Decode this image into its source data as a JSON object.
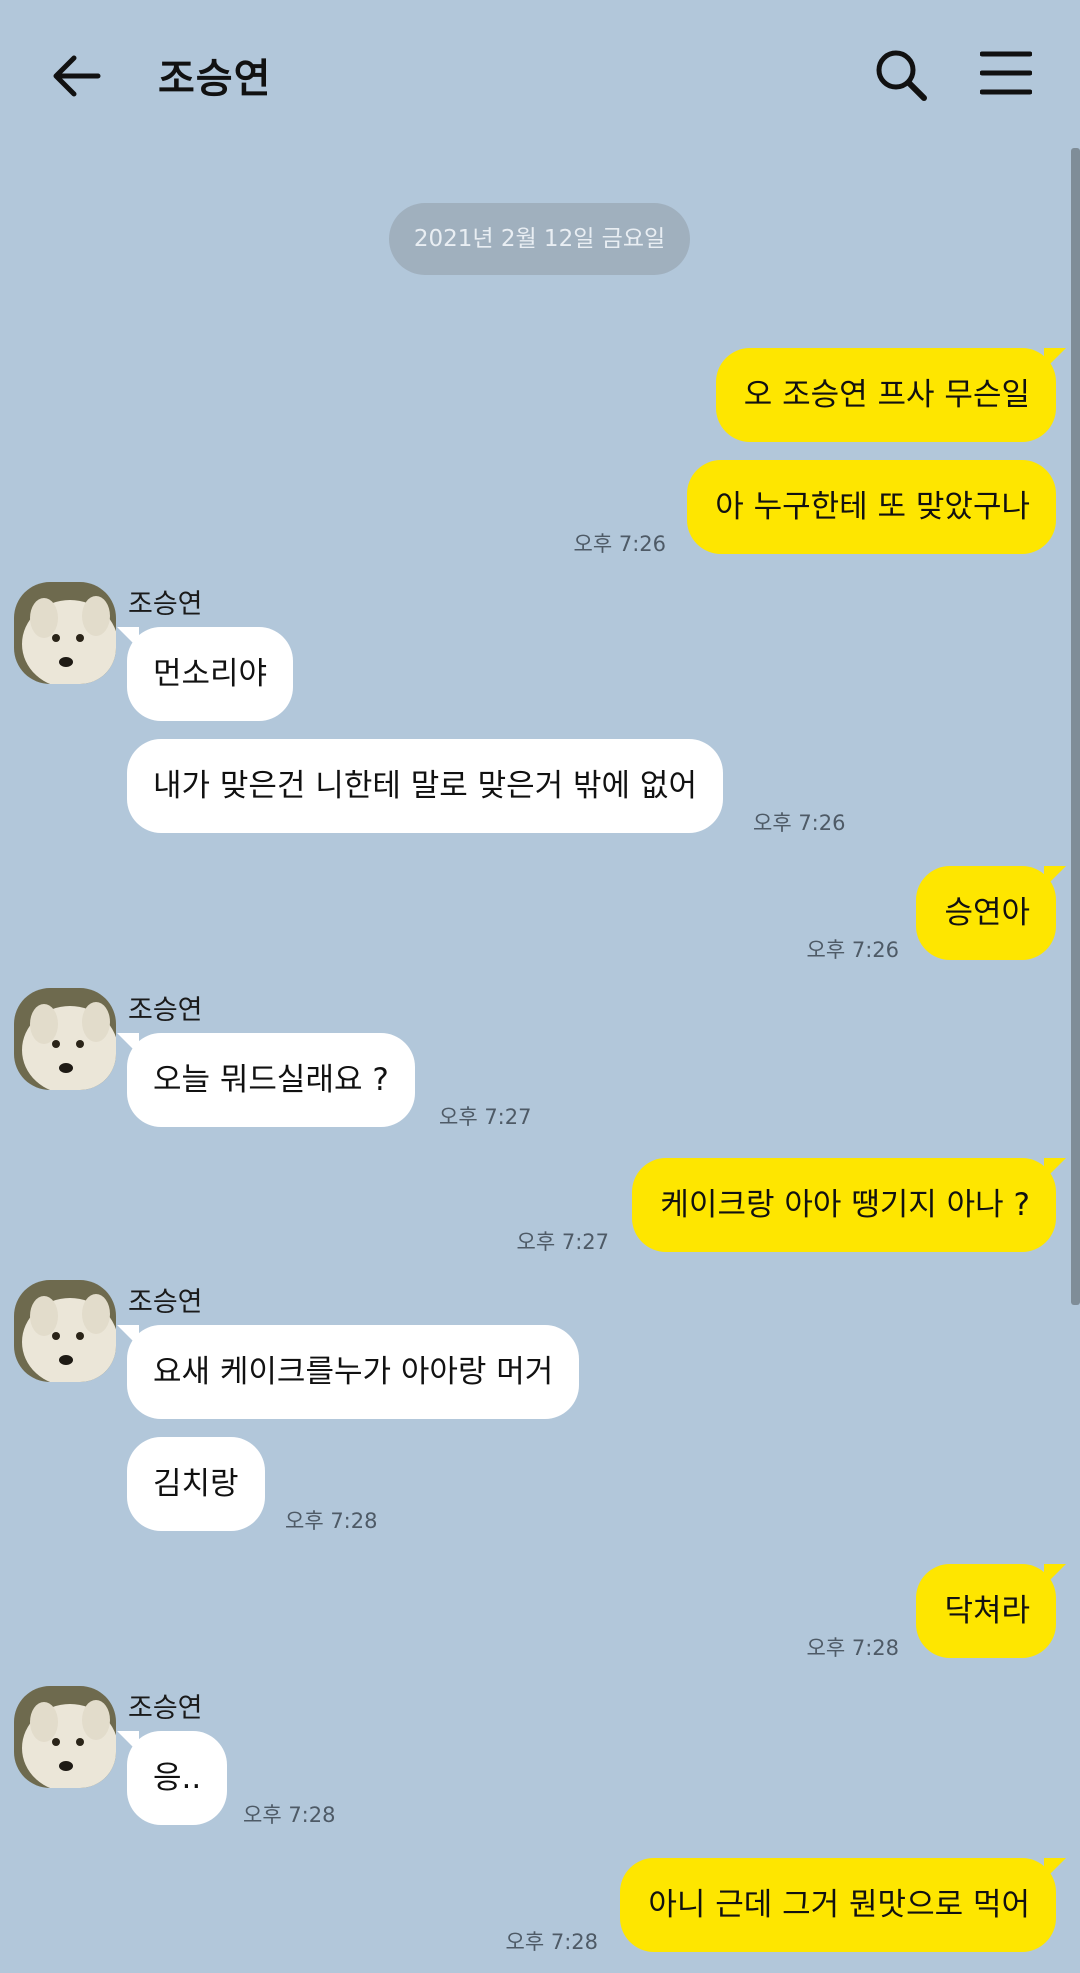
{
  "header": {
    "title": "조승연"
  },
  "date_divider": "2021년 2월 12일 금요일",
  "contact": {
    "name": "조승연"
  },
  "messages": [
    {
      "text": "오 조승연 프사 무슨일",
      "time": ""
    },
    {
      "text": "아 누구한테 또 맞았구나",
      "time": "오후 7:26"
    },
    {
      "text": "먼소리야",
      "time": ""
    },
    {
      "text": "내가 맞은건 니한테 말로 맞은거 밖에 없어",
      "time": "오후 7:26"
    },
    {
      "text": "승연아",
      "time": "오후 7:26"
    },
    {
      "text": "오늘 뭐드실래요 ?",
      "time": "오후 7:27"
    },
    {
      "text": "케이크랑 아아 땡기지 아나 ?",
      "time": "오후 7:27"
    },
    {
      "text": "요새 케이크를누가 아아랑 머거",
      "time": ""
    },
    {
      "text": "김치랑",
      "time": "오후 7:28"
    },
    {
      "text": "닥쳐라",
      "time": "오후 7:28"
    },
    {
      "text": "응..",
      "time": "오후 7:28"
    },
    {
      "text": "아니 근데 그거 뭔맛으로 먹어",
      "time": "오후 7:28"
    }
  ],
  "colors": {
    "background": "#b2c7da",
    "my_bubble": "#fee600",
    "their_bubble": "#ffffff"
  },
  "icons": {
    "back": "arrow-left-icon",
    "search": "search-icon",
    "menu": "hamburger-menu-icon",
    "avatar": "dog-avatar"
  }
}
